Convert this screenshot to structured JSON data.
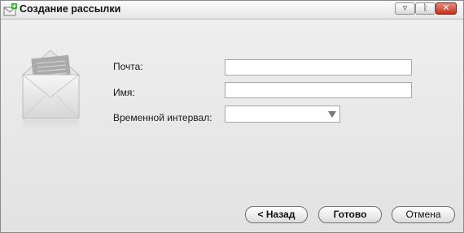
{
  "window": {
    "title": "Создание рассылки",
    "icons": {
      "app": "mail-add-icon",
      "minimize": "minimize-icon",
      "restore": "restore-icon",
      "close": "close-icon"
    },
    "controls": {
      "minimize": "▿",
      "restore": "ᚱ",
      "close": "✕"
    }
  },
  "illustration": {
    "icon": "open-envelope-icon"
  },
  "form": {
    "email": {
      "label": "Почта:",
      "value": "",
      "placeholder": ""
    },
    "name": {
      "label": "Имя:",
      "value": "",
      "placeholder": ""
    },
    "interval": {
      "label": "Временной интервал:",
      "value": ""
    }
  },
  "buttons": {
    "back": "< Назад",
    "done": "Готово",
    "cancel": "Отмена"
  },
  "colors": {
    "close_button": "#c2331e",
    "accent_icon": "#3aa53a"
  }
}
